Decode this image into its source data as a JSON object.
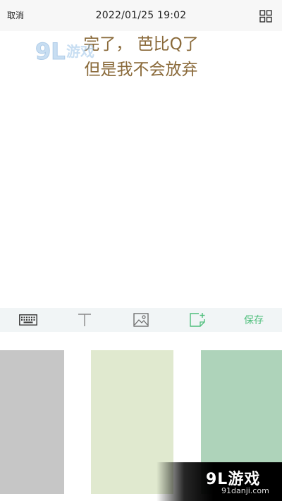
{
  "topbar": {
    "cancel_label": "取消",
    "datetime": "2022/01/25 19:02",
    "grid_icon": "grid-icon"
  },
  "editor": {
    "lines": [
      "完了， 芭比Q了",
      "但是我不会放弃"
    ],
    "text_color": "#8a6a3a"
  },
  "toolbar": {
    "keyboard_icon": "keyboard-icon",
    "text_icon": "text-format-icon",
    "image_icon": "image-icon",
    "add_note_icon": "add-note-icon",
    "save_label": "保存",
    "save_color": "#4fbf7c"
  },
  "palette": {
    "swatches": [
      {
        "color": "#c6c6c6"
      },
      {
        "color": "#e0e9cf"
      },
      {
        "color": "#aed3ba"
      }
    ]
  },
  "watermark": {
    "logo": "9L游戏",
    "url": "91danji.com"
  }
}
